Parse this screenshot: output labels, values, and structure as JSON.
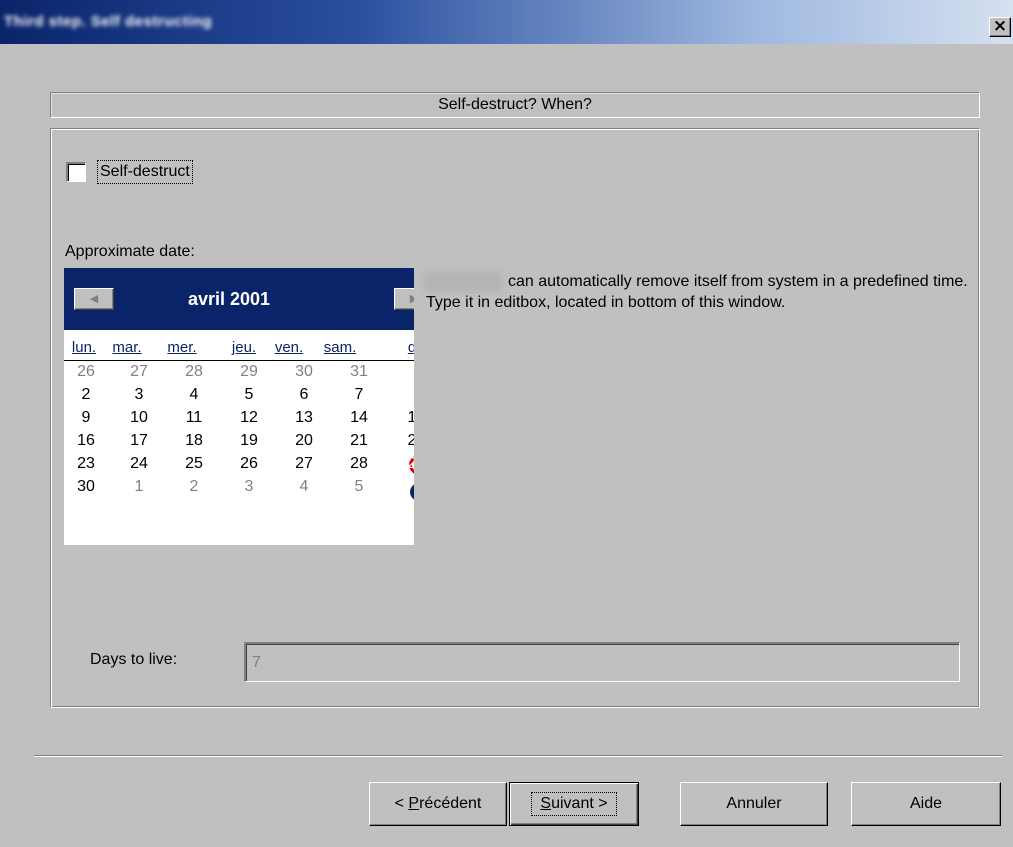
{
  "window": {
    "title": "Third step. Self destructing",
    "close_label": "×"
  },
  "header": {
    "text": "Self-destruct? When?"
  },
  "self_destruct": {
    "label": "Self-destruct",
    "checked": false
  },
  "calendar": {
    "label": "Approximate date:",
    "month_title": "avril 2001",
    "prev_glyph": "◀",
    "next_glyph": "▶",
    "weekdays": [
      "lun.",
      "mar.",
      "mer.",
      "jeu.",
      "ven.",
      "sam.",
      "d"
    ],
    "weeks": [
      [
        "26",
        "27",
        "28",
        "29",
        "30",
        "31",
        ""
      ],
      [
        "2",
        "3",
        "4",
        "5",
        "6",
        "7",
        ""
      ],
      [
        "9",
        "10",
        "11",
        "12",
        "13",
        "14",
        "1"
      ],
      [
        "16",
        "17",
        "18",
        "19",
        "20",
        "21",
        "2"
      ],
      [
        "23",
        "24",
        "25",
        "26",
        "27",
        "28",
        "2"
      ],
      [
        "30",
        "1",
        "2",
        "3",
        "4",
        "5",
        ""
      ]
    ]
  },
  "info": {
    "text": "can automatically remove itself from system in a predefined time. Type it in editbox, located in bottom of this window."
  },
  "days_to_live": {
    "label": "Days to live:",
    "value": "7"
  },
  "buttons": {
    "prev_underline": "P",
    "prev_rest": "récédent",
    "next_underline": "S",
    "next_rest": "uivant >",
    "cancel": "Annuler",
    "help": "Aide"
  }
}
